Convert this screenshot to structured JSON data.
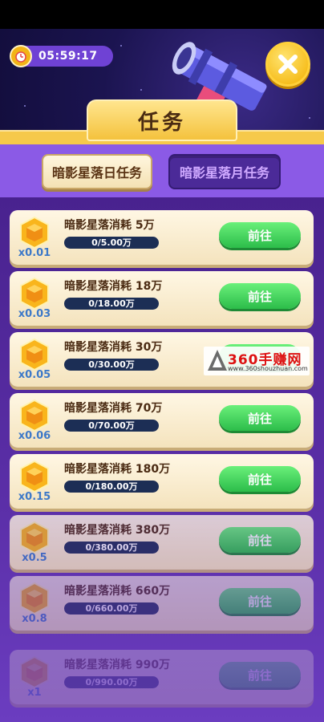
{
  "timer": {
    "time": "05:59:17"
  },
  "header": {
    "title": "任务"
  },
  "tabs": [
    {
      "label": "暗影星落日任务",
      "active": true
    },
    {
      "label": "暗影星落月任务",
      "active": false
    }
  ],
  "tasks": [
    {
      "title": "暗影星落消耗 5万",
      "progress_text": "0/5.00万",
      "progress": 0,
      "multiplier": "x0.01",
      "button": "前往"
    },
    {
      "title": "暗影星落消耗 18万",
      "progress_text": "0/18.00万",
      "progress": 0,
      "multiplier": "x0.03",
      "button": "前往"
    },
    {
      "title": "暗影星落消耗 30万",
      "progress_text": "0/30.00万",
      "progress": 0,
      "multiplier": "x0.05",
      "button": "前往"
    },
    {
      "title": "暗影星落消耗 70万",
      "progress_text": "0/70.00万",
      "progress": 0,
      "multiplier": "x0.06",
      "button": "前往"
    },
    {
      "title": "暗影星落消耗 180万",
      "progress_text": "0/180.00万",
      "progress": 0,
      "multiplier": "x0.15",
      "button": "前往"
    },
    {
      "title": "暗影星落消耗 380万",
      "progress_text": "0/380.00万",
      "progress": 0,
      "multiplier": "x0.5",
      "button": "前往"
    },
    {
      "title": "暗影星落消耗 660万",
      "progress_text": "0/660.00万",
      "progress": 0,
      "multiplier": "x0.8",
      "button": "前往"
    },
    {
      "title": "暗影星落消耗 990万",
      "progress_text": "0/990.00万",
      "progress": 0,
      "multiplier": "x1",
      "button": "前往"
    }
  ],
  "watermark": {
    "title": "360手赚网",
    "url": "www.360shouzhuan.com"
  },
  "colors": {
    "accent_gold": "#f4c23d",
    "button_green": "#2cbd4a",
    "panel_purple": "#8b5ae6"
  }
}
